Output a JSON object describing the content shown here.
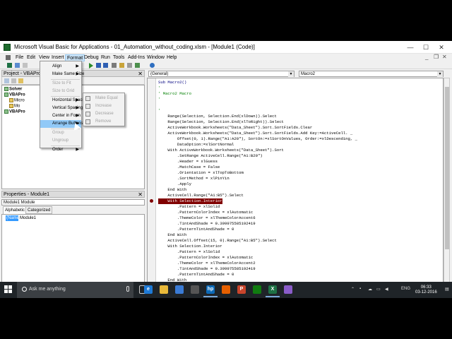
{
  "window": {
    "title": "Microsoft Visual Basic for Applications - 01_Automation_without_coding.xlsm - [Module1 (Code)]",
    "controls": {
      "minimize": "—",
      "maximize": "☐",
      "close": "✕"
    },
    "mdi_controls": {
      "minimize": "_",
      "restore": "❐",
      "close": "✕"
    }
  },
  "menubar": [
    "File",
    "Edit",
    "View",
    "Insert",
    "Format",
    "Debug",
    "Run",
    "Tools",
    "Add-Ins",
    "Window",
    "Help"
  ],
  "format_menu": {
    "items": [
      {
        "label": "Align",
        "submenu": true,
        "disabled": false
      },
      {
        "label": "Make Same Size",
        "submenu": true,
        "disabled": false
      },
      {
        "label": "Size to Fit",
        "submenu": false,
        "disabled": true
      },
      {
        "label": "Size to Grid",
        "submenu": false,
        "disabled": true
      },
      {
        "label": "Horizontal Spacing",
        "submenu": true,
        "disabled": false
      },
      {
        "label": "Vertical Spacing",
        "submenu": true,
        "disabled": false
      },
      {
        "label": "Center in Form",
        "submenu": true,
        "disabled": false
      },
      {
        "label": "Arrange Buttons",
        "submenu": true,
        "disabled": false,
        "hover": true
      },
      {
        "label": "Group",
        "submenu": false,
        "disabled": true
      },
      {
        "label": "Ungroup",
        "submenu": false,
        "disabled": true
      },
      {
        "label": "Order",
        "submenu": true,
        "disabled": false
      }
    ],
    "submenu": [
      "Make Equal",
      "Increase",
      "Decrease",
      "Remove"
    ]
  },
  "project_panel": {
    "title": "Project - VBAProject",
    "close": "✕",
    "tree": [
      "Solver",
      "VBAPro",
      "Micro",
      "Mo",
      "VBAPro"
    ]
  },
  "properties_panel": {
    "title": "Properties - Module1",
    "close": "✕",
    "object": "Module1 Module",
    "tabs": [
      "Alphabetic",
      "Categorized"
    ],
    "row": {
      "name": "(Name)",
      "value": "Module1"
    }
  },
  "code": {
    "object_combo": "(General)",
    "proc_combo": "Macro2",
    "lines": [
      {
        "t": "Sub Macro2()",
        "k": "kw"
      },
      {
        "t": "'",
        "k": "cm"
      },
      {
        "t": "' Macro2 Macro",
        "k": "cm"
      },
      {
        "t": "'",
        "k": "cm"
      },
      {
        "t": "",
        "k": ""
      },
      {
        "t": "'",
        "k": "cm"
      },
      {
        "t": "    Range(Selection, Selection.End(xlDown)).Select",
        "k": ""
      },
      {
        "t": "    Range(Selection, Selection.End(xlToRight)).Select",
        "k": ""
      },
      {
        "t": "    ActiveWorkbook.Worksheets(\"Data_Sheet\").Sort.SortFields.Clear",
        "k": ""
      },
      {
        "t": "    ActiveWorkbook.Worksheets(\"Data_Sheet\").Sort.SortFields.Add Key:=ActiveCell. _",
        "k": ""
      },
      {
        "t": "        Offset(0, 1).Range(\"A1:A20\"), SortOn:=xlSortOnValues, Order:=xlDescending, _",
        "k": ""
      },
      {
        "t": "        DataOption:=xlSortNormal",
        "k": ""
      },
      {
        "t": "    With ActiveWorkbook.Worksheets(\"Data_Sheet\").Sort",
        "k": ""
      },
      {
        "t": "        .SetRange ActiveCell.Range(\"A1:B20\")",
        "k": ""
      },
      {
        "t": "        .Header = xlGuess",
        "k": ""
      },
      {
        "t": "        .MatchCase = False",
        "k": ""
      },
      {
        "t": "        .Orientation = xlTopToBottom",
        "k": ""
      },
      {
        "t": "        .SortMethod = xlPinYin",
        "k": ""
      },
      {
        "t": "        .Apply",
        "k": ""
      },
      {
        "t": "    End With",
        "k": ""
      },
      {
        "t": "    ActiveCell.Range(\"A1:B5\").Select",
        "k": ""
      },
      {
        "t": "    With Selection.Interior",
        "k": "hl"
      },
      {
        "t": "        .Pattern = xlSolid",
        "k": ""
      },
      {
        "t": "        .PatternColorIndex = xlAutomatic",
        "k": ""
      },
      {
        "t": "        .ThemeColor = xlThemeColorAccent6",
        "k": ""
      },
      {
        "t": "        .TintAndShade = 0.399975585192419",
        "k": ""
      },
      {
        "t": "        .PatternTintAndShade = 0",
        "k": ""
      },
      {
        "t": "    End With",
        "k": ""
      },
      {
        "t": "    ActiveCell.Offset(15, 0).Range(\"A1:B5\").Select",
        "k": ""
      },
      {
        "t": "    With Selection.Interior",
        "k": ""
      },
      {
        "t": "        .Pattern = xlSolid",
        "k": ""
      },
      {
        "t": "        .PatternColorIndex = xlAutomatic",
        "k": ""
      },
      {
        "t": "        .ThemeColor = xlThemeColorAccent2",
        "k": ""
      },
      {
        "t": "        .TintAndShade = 0.399975585192419",
        "k": ""
      },
      {
        "t": "        .PatternTintAndShade = 0",
        "k": ""
      },
      {
        "t": "    End With",
        "k": ""
      }
    ],
    "breakpoint_line": 21
  },
  "taskbar": {
    "search_placeholder": "Ask me anything",
    "apps": [
      {
        "name": "edge-icon",
        "glyph": "e",
        "color": "#1e7ad6"
      },
      {
        "name": "file-explorer-icon",
        "glyph": "",
        "color": "#e8b93a"
      },
      {
        "name": "store-icon",
        "glyph": "",
        "color": "#3a7bd5"
      },
      {
        "name": "lock-icon",
        "glyph": "",
        "color": "#555555"
      },
      {
        "name": "hp-icon",
        "glyph": "hp",
        "color": "#0c6ab8"
      },
      {
        "name": "firefox-icon",
        "glyph": "",
        "color": "#e66000"
      },
      {
        "name": "powerpoint-icon",
        "glyph": "P",
        "color": "#c9452c"
      },
      {
        "name": "xbox-icon",
        "glyph": "",
        "color": "#107c10"
      },
      {
        "name": "excel-icon",
        "glyph": "X",
        "color": "#1e7145"
      },
      {
        "name": "paint-icon",
        "glyph": "",
        "color": "#8a5cc9"
      }
    ],
    "tray_language": "ENG",
    "time": "06:33",
    "date": "03-12-2016"
  },
  "colors": {
    "highlight": "#800000",
    "keyword": "#00007f",
    "comment": "#007f00",
    "menu_hover": "#91c9f7"
  }
}
